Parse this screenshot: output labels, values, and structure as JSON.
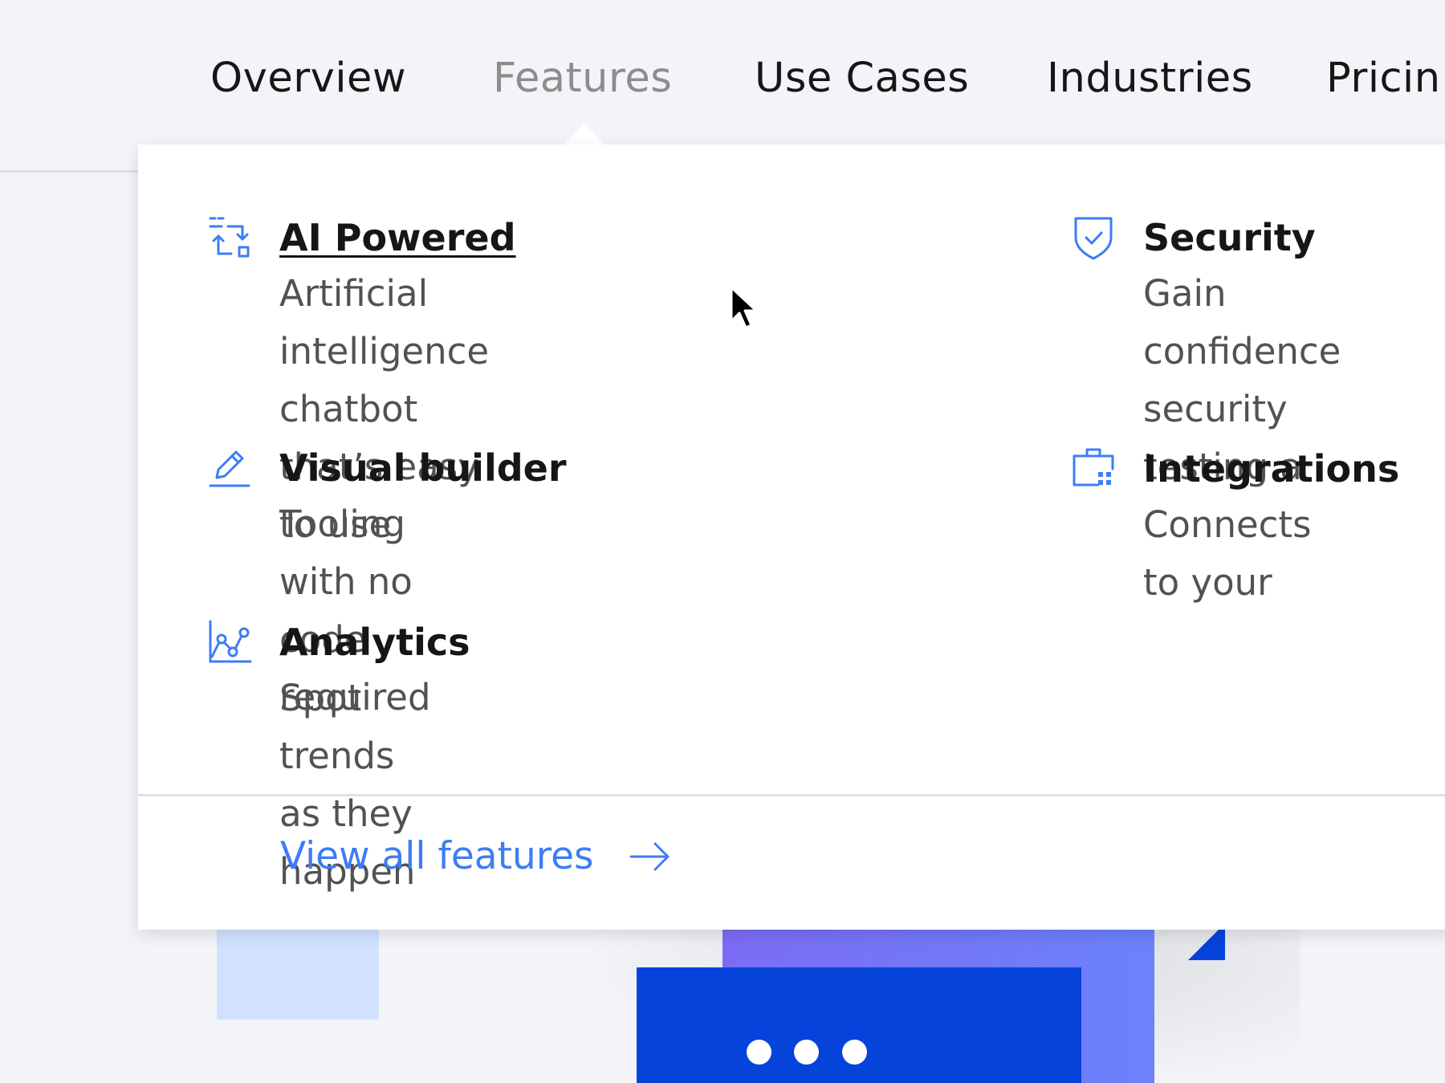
{
  "nav": {
    "items": [
      {
        "label": "Overview"
      },
      {
        "label": "Features",
        "active": true
      },
      {
        "label": "Use Cases"
      },
      {
        "label": "Industries"
      },
      {
        "label": "Pricin"
      }
    ]
  },
  "menu": {
    "features": [
      {
        "title": "AI Powered",
        "description": "Artificial intelligence chatbot\nthat’s easy to use",
        "icon": "ai-automation-icon",
        "hovered": true
      },
      {
        "title": "Visual builder",
        "description": "Tooling with no code required",
        "icon": "pencil-icon"
      },
      {
        "title": "Analytics",
        "description": "Spot trends as they happen",
        "icon": "analytics-chart-icon"
      },
      {
        "title": "Security",
        "description": "Gain confidence\nsecurity testing a",
        "icon": "shield-check-icon"
      },
      {
        "title": "Integrations",
        "description": "Connects to your",
        "icon": "briefcase-grid-icon"
      }
    ],
    "view_all_label": "View all features",
    "view_all_icon": "arrow-right-icon"
  },
  "colors": {
    "accent": "#3d7df5",
    "title": "#161616",
    "description": "#525252",
    "nav_active": "#8d8d8d",
    "background": "#f2f4f8",
    "illustration_blue": "#0543db",
    "illustration_purple": "#7b6cf6",
    "illustration_light": "#d0e2ff"
  }
}
